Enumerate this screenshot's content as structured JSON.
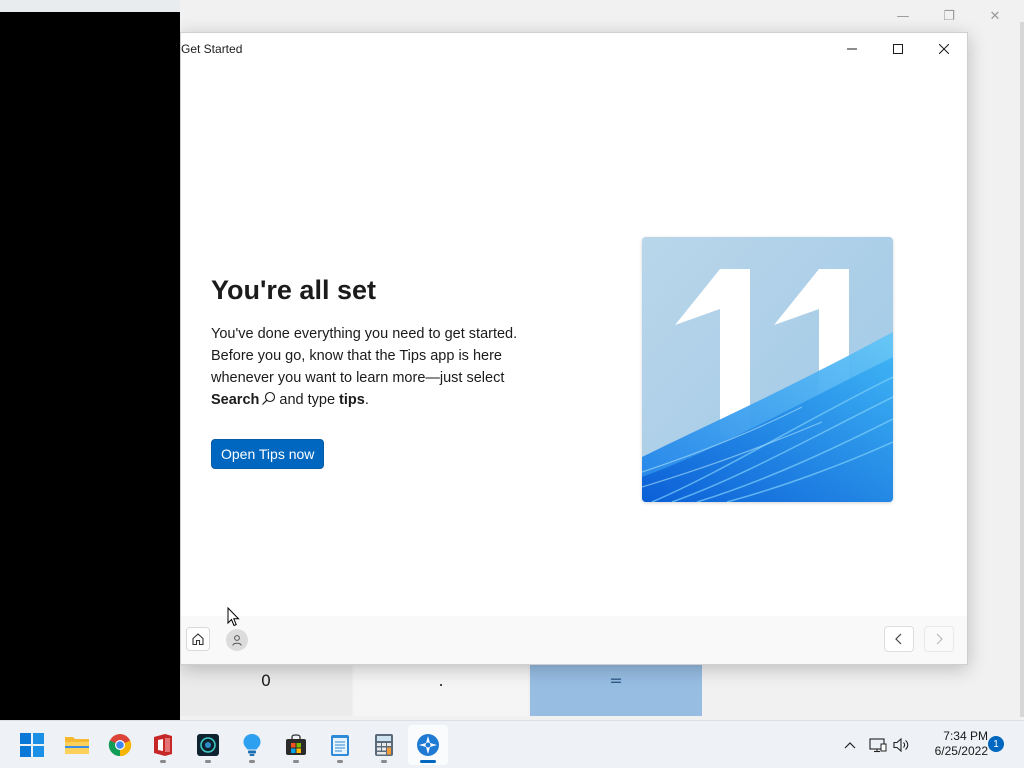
{
  "background_window": {
    "controls": {
      "minimize": "—",
      "restore": "❐",
      "close": "✕"
    },
    "calculator_keys": {
      "zero": "0",
      "decimal": ".",
      "equals": "="
    }
  },
  "window": {
    "title": "Get Started",
    "controls": {
      "minimize": "minimize-icon",
      "maximize": "maximize-icon",
      "close": "close-icon"
    }
  },
  "main": {
    "heading": "You're all set",
    "description": {
      "line1": "You've done everything you need to get started.",
      "line2": "Before you go, know that the Tips app is here",
      "line3": "whenever you want to learn more—just select",
      "search_word": "Search",
      "and_type": "and type",
      "tips_word": "tips",
      "period": "."
    },
    "button_label": "Open Tips now",
    "hero_image": {
      "text": "11",
      "colors": {
        "sky": "#a9cde6",
        "bloom": "#1a8fe8"
      }
    }
  },
  "footer": {
    "home": "home-icon",
    "account": "person-icon",
    "prev": "chevron-left-icon",
    "next": "chevron-right-icon"
  },
  "taskbar": {
    "apps": [
      {
        "name": "start",
        "icon": "windows-logo-icon"
      },
      {
        "name": "file-explorer",
        "icon": "folder-icon"
      },
      {
        "name": "chrome",
        "icon": "chrome-icon"
      },
      {
        "name": "office",
        "icon": "office-icon"
      },
      {
        "name": "app-dark",
        "icon": "app-icon"
      },
      {
        "name": "tips",
        "icon": "lightbulb-icon"
      },
      {
        "name": "store",
        "icon": "store-icon"
      },
      {
        "name": "notepad",
        "icon": "notepad-icon"
      },
      {
        "name": "calculator",
        "icon": "calculator-icon"
      },
      {
        "name": "get-started",
        "icon": "get-started-icon",
        "active": true
      }
    ],
    "clock": {
      "time": "7:34 PM",
      "date": "6/25/2022"
    },
    "notification_count": "1"
  },
  "colors": {
    "accent": "#0067c0",
    "taskbar": "#eef1f5"
  }
}
